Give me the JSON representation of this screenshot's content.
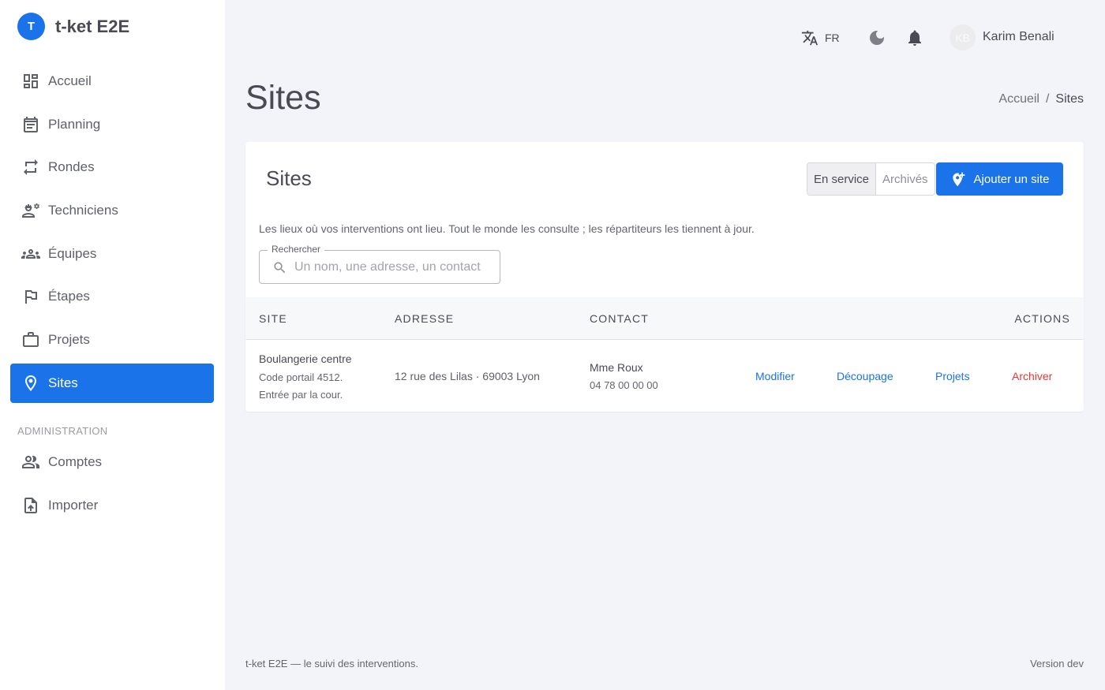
{
  "app": {
    "logo_letter": "T",
    "title": "t-ket E2E"
  },
  "sidebar": {
    "items": [
      {
        "label": "Accueil",
        "icon": "dashboard-icon"
      },
      {
        "label": "Planning",
        "icon": "calendar-icon"
      },
      {
        "label": "Rondes",
        "icon": "repeat-icon"
      },
      {
        "label": "Techniciens",
        "icon": "engineer-icon"
      },
      {
        "label": "Équipes",
        "icon": "groups-icon"
      },
      {
        "label": "Étapes",
        "icon": "flag-icon"
      },
      {
        "label": "Projets",
        "icon": "briefcase-icon"
      },
      {
        "label": "Sites",
        "icon": "location-pin-icon",
        "active": true
      }
    ],
    "section_label": "ADMINISTRATION",
    "admin_items": [
      {
        "label": "Comptes",
        "icon": "people-icon"
      },
      {
        "label": "Importer",
        "icon": "file-upload-icon"
      }
    ]
  },
  "topbar": {
    "language": "FR",
    "user_initials": "KB",
    "user_name": "Karim Benali"
  },
  "header": {
    "title": "Sites",
    "breadcrumb": [
      "Accueil",
      "Sites"
    ]
  },
  "card": {
    "title": "Sites",
    "filter_active": "En service",
    "filter_inactive": "Archivés",
    "add_button": "Ajouter un site",
    "description": "Les lieux où vos interventions ont lieu. Tout le monde les consulte ; les répartiteurs les tiennent à jour.",
    "search": {
      "label": "Rechercher",
      "placeholder": "Un nom, une adresse, un contact"
    },
    "columns": [
      "SITE",
      "ADRESSE",
      "CONTACT",
      "ACTIONS"
    ],
    "rows": [
      {
        "site_name": "Boulangerie centre",
        "site_note_1": "Code portail 4512.",
        "site_note_2": "Entrée par la cour.",
        "address": "12 rue des Lilas · 69003 Lyon",
        "contact_name": "Mme Roux",
        "contact_phone": "04 78 00 00 00",
        "actions": [
          "Modifier",
          "Découpage",
          "Projets",
          "Archiver"
        ]
      }
    ]
  },
  "footer": {
    "left": "t-ket E2E — le suivi des interventions.",
    "right": "Version dev"
  },
  "colors": {
    "accent": "#1a73e8",
    "danger": "#e53935",
    "background": "#f3f4f9"
  }
}
